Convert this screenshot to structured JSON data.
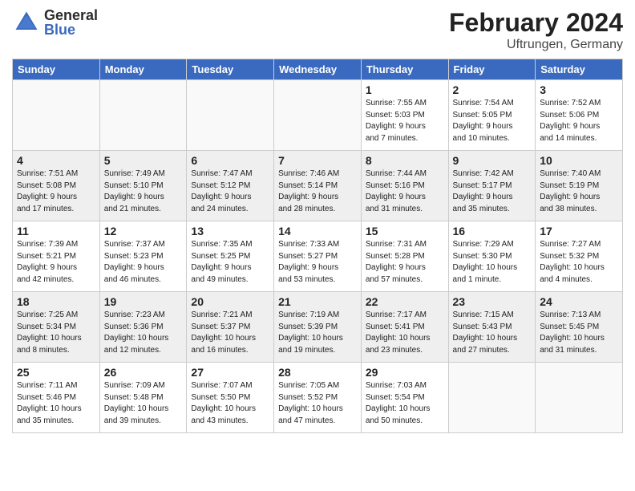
{
  "header": {
    "logo_general": "General",
    "logo_blue": "Blue",
    "month": "February 2024",
    "location": "Uftrungen, Germany"
  },
  "weekdays": [
    "Sunday",
    "Monday",
    "Tuesday",
    "Wednesday",
    "Thursday",
    "Friday",
    "Saturday"
  ],
  "weeks": [
    [
      {
        "day": "",
        "info": ""
      },
      {
        "day": "",
        "info": ""
      },
      {
        "day": "",
        "info": ""
      },
      {
        "day": "",
        "info": ""
      },
      {
        "day": "1",
        "info": "Sunrise: 7:55 AM\nSunset: 5:03 PM\nDaylight: 9 hours\nand 7 minutes."
      },
      {
        "day": "2",
        "info": "Sunrise: 7:54 AM\nSunset: 5:05 PM\nDaylight: 9 hours\nand 10 minutes."
      },
      {
        "day": "3",
        "info": "Sunrise: 7:52 AM\nSunset: 5:06 PM\nDaylight: 9 hours\nand 14 minutes."
      }
    ],
    [
      {
        "day": "4",
        "info": "Sunrise: 7:51 AM\nSunset: 5:08 PM\nDaylight: 9 hours\nand 17 minutes."
      },
      {
        "day": "5",
        "info": "Sunrise: 7:49 AM\nSunset: 5:10 PM\nDaylight: 9 hours\nand 21 minutes."
      },
      {
        "day": "6",
        "info": "Sunrise: 7:47 AM\nSunset: 5:12 PM\nDaylight: 9 hours\nand 24 minutes."
      },
      {
        "day": "7",
        "info": "Sunrise: 7:46 AM\nSunset: 5:14 PM\nDaylight: 9 hours\nand 28 minutes."
      },
      {
        "day": "8",
        "info": "Sunrise: 7:44 AM\nSunset: 5:16 PM\nDaylight: 9 hours\nand 31 minutes."
      },
      {
        "day": "9",
        "info": "Sunrise: 7:42 AM\nSunset: 5:17 PM\nDaylight: 9 hours\nand 35 minutes."
      },
      {
        "day": "10",
        "info": "Sunrise: 7:40 AM\nSunset: 5:19 PM\nDaylight: 9 hours\nand 38 minutes."
      }
    ],
    [
      {
        "day": "11",
        "info": "Sunrise: 7:39 AM\nSunset: 5:21 PM\nDaylight: 9 hours\nand 42 minutes."
      },
      {
        "day": "12",
        "info": "Sunrise: 7:37 AM\nSunset: 5:23 PM\nDaylight: 9 hours\nand 46 minutes."
      },
      {
        "day": "13",
        "info": "Sunrise: 7:35 AM\nSunset: 5:25 PM\nDaylight: 9 hours\nand 49 minutes."
      },
      {
        "day": "14",
        "info": "Sunrise: 7:33 AM\nSunset: 5:27 PM\nDaylight: 9 hours\nand 53 minutes."
      },
      {
        "day": "15",
        "info": "Sunrise: 7:31 AM\nSunset: 5:28 PM\nDaylight: 9 hours\nand 57 minutes."
      },
      {
        "day": "16",
        "info": "Sunrise: 7:29 AM\nSunset: 5:30 PM\nDaylight: 10 hours\nand 1 minute."
      },
      {
        "day": "17",
        "info": "Sunrise: 7:27 AM\nSunset: 5:32 PM\nDaylight: 10 hours\nand 4 minutes."
      }
    ],
    [
      {
        "day": "18",
        "info": "Sunrise: 7:25 AM\nSunset: 5:34 PM\nDaylight: 10 hours\nand 8 minutes."
      },
      {
        "day": "19",
        "info": "Sunrise: 7:23 AM\nSunset: 5:36 PM\nDaylight: 10 hours\nand 12 minutes."
      },
      {
        "day": "20",
        "info": "Sunrise: 7:21 AM\nSunset: 5:37 PM\nDaylight: 10 hours\nand 16 minutes."
      },
      {
        "day": "21",
        "info": "Sunrise: 7:19 AM\nSunset: 5:39 PM\nDaylight: 10 hours\nand 19 minutes."
      },
      {
        "day": "22",
        "info": "Sunrise: 7:17 AM\nSunset: 5:41 PM\nDaylight: 10 hours\nand 23 minutes."
      },
      {
        "day": "23",
        "info": "Sunrise: 7:15 AM\nSunset: 5:43 PM\nDaylight: 10 hours\nand 27 minutes."
      },
      {
        "day": "24",
        "info": "Sunrise: 7:13 AM\nSunset: 5:45 PM\nDaylight: 10 hours\nand 31 minutes."
      }
    ],
    [
      {
        "day": "25",
        "info": "Sunrise: 7:11 AM\nSunset: 5:46 PM\nDaylight: 10 hours\nand 35 minutes."
      },
      {
        "day": "26",
        "info": "Sunrise: 7:09 AM\nSunset: 5:48 PM\nDaylight: 10 hours\nand 39 minutes."
      },
      {
        "day": "27",
        "info": "Sunrise: 7:07 AM\nSunset: 5:50 PM\nDaylight: 10 hours\nand 43 minutes."
      },
      {
        "day": "28",
        "info": "Sunrise: 7:05 AM\nSunset: 5:52 PM\nDaylight: 10 hours\nand 47 minutes."
      },
      {
        "day": "29",
        "info": "Sunrise: 7:03 AM\nSunset: 5:54 PM\nDaylight: 10 hours\nand 50 minutes."
      },
      {
        "day": "",
        "info": ""
      },
      {
        "day": "",
        "info": ""
      }
    ]
  ]
}
